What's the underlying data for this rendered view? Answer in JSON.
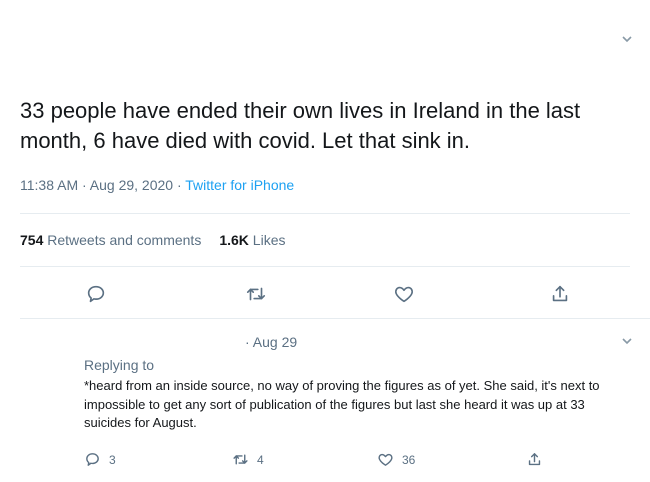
{
  "tweet": {
    "text": "33 people have ended their own lives in Ireland in the last month, 6 have died with covid. Let that sink in.",
    "time": "11:38 AM · Aug 29, 2020 · ",
    "source": "Twitter for iPhone",
    "retweets_count": "754",
    "retweets_label": "Retweets and comments",
    "likes_count": "1.6K",
    "likes_label": "Likes"
  },
  "reply": {
    "date": "· Aug 29",
    "replying_to": "Replying to",
    "text": "*heard from an inside source, no way of proving the figures as of yet. She said, it's next to impossible to get any sort of publication of the figures but last she heard it was up at 33 suicides for August.",
    "replies_count": "3",
    "retweets_count": "4",
    "likes_count": "36"
  },
  "icons": {
    "more": "chevron-down-icon",
    "reply": "comment-icon",
    "retweet": "retweet-icon",
    "like": "heart-icon",
    "share": "share-icon"
  },
  "colors": {
    "text": "#14171a",
    "muted": "#5b7083",
    "accent": "#1da1f2",
    "divider": "#e6ecf0"
  }
}
